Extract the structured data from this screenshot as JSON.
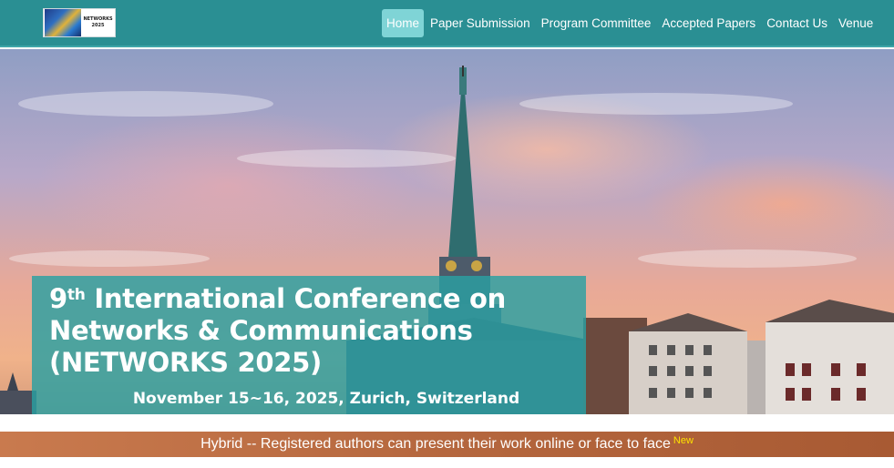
{
  "header": {
    "logo_text_line1": "NETWORKS",
    "logo_text_line2": "2025",
    "nav": [
      {
        "label": "Home",
        "active": true
      },
      {
        "label": "Paper Submission",
        "active": false
      },
      {
        "label": "Program Committee",
        "active": false
      },
      {
        "label": "Accepted Papers",
        "active": false
      },
      {
        "label": "Contact Us",
        "active": false
      },
      {
        "label": "Venue",
        "active": false
      }
    ]
  },
  "hero": {
    "title_num": "9",
    "title_sup": "th",
    "title_rest_line1": " International Conference on",
    "title_line2": "Networks & Communications",
    "title_line3": "(NETWORKS 2025)",
    "dates": "November 15~16, 2025, Zurich, Switzerland"
  },
  "banner": {
    "text": "Hybrid -- Registered authors can present their work online or face to face",
    "badge": "New"
  },
  "colors": {
    "navbar": "#2a8f93",
    "active_tab": "#7fd4d6",
    "title_box": "#2aa0a2",
    "banner": "#b5673e",
    "badge": "#ffe200"
  }
}
